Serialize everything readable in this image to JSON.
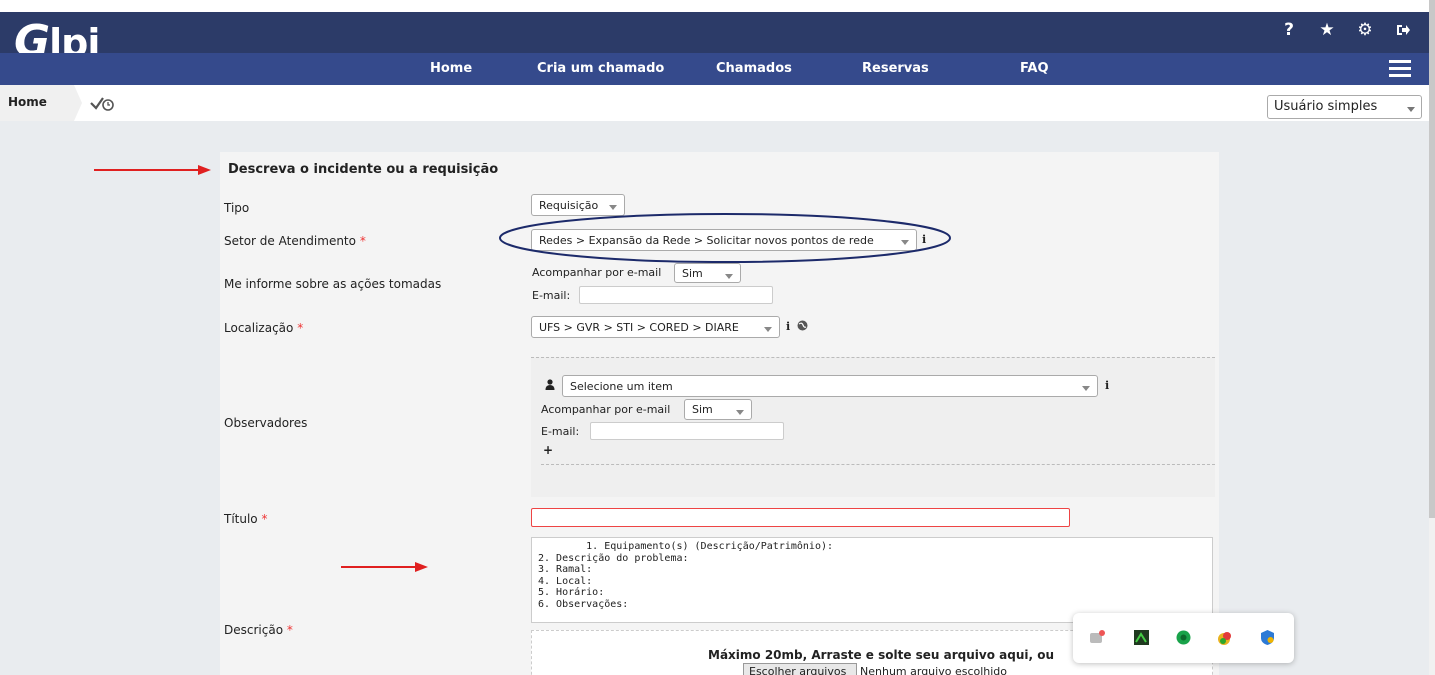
{
  "header": {
    "logo_text": "Glpi",
    "menu": [
      "Home",
      "Cria um chamado",
      "Chamados",
      "Reservas",
      "FAQ"
    ],
    "icons": [
      "help-icon",
      "star-icon",
      "gear-icon",
      "logout-icon",
      "hamburger-menu-icon"
    ],
    "help_glyph": "?",
    "star_glyph": "★",
    "gear_glyph": "⚙",
    "logout_glyph": "⇥"
  },
  "breadcrumb": {
    "home": "Home"
  },
  "profile": {
    "selected": "Usuário simples"
  },
  "form": {
    "section_title": "Descreva o incidente ou a requisição",
    "required_mark": "*",
    "tipo": {
      "label": "Tipo",
      "value": "Requisição"
    },
    "setor": {
      "label": "Setor de Atendimento",
      "value": "Redes > Expansão da Rede > Solicitar novos pontos de rede"
    },
    "acoes": {
      "label": "Me informe sobre as ações tomadas",
      "follow_label": "Acompanhar por e-mail",
      "follow_value": "Sim",
      "email_label": "E-mail:"
    },
    "localizacao": {
      "label": "Localização",
      "value": "UFS > GVR > STI > CORED > DIARE"
    },
    "observadores": {
      "label": "Observadores",
      "select_placeholder": "Selecione um item",
      "follow_label": "Acompanhar por e-mail",
      "follow_value": "Sim",
      "email_label": "E-mail:",
      "add_glyph": "+"
    },
    "titulo": {
      "label": "Título",
      "value": ""
    },
    "descricao": {
      "label": "Descrição",
      "text": "        1. Equipamento(s) (Descrição/Patrimônio):\n2. Descrição do problema:\n3. Ramal:\n4. Local:\n5. Horário:\n6. Observações:"
    },
    "upload": {
      "text": "Máximo 20mb, Arraste e solte seu arquivo aqui, ou",
      "button": "Escolher arquivos",
      "status": "Nenhum arquivo escolhido"
    },
    "info_glyph": "i"
  },
  "colors": {
    "header_dark": "#2c3b68",
    "menu_bar": "#354a8c",
    "required": "#e33333",
    "annotation_arrow": "#e02020",
    "annotation_ellipse": "#1c2a6a"
  },
  "tray_icons": [
    "tray-app-icon-1",
    "tray-app-icon-2",
    "tray-app-icon-3",
    "tray-app-icon-4",
    "tray-app-icon-5"
  ]
}
